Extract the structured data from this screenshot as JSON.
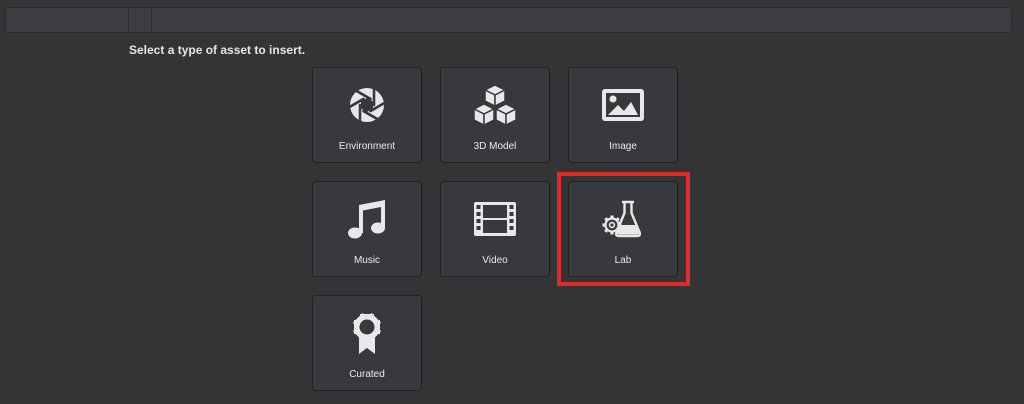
{
  "prompt": "Select a type of asset to insert.",
  "tiles": [
    {
      "label": "Environment",
      "icon": "aperture-icon"
    },
    {
      "label": "3D Model",
      "icon": "cubes-icon"
    },
    {
      "label": "Image",
      "icon": "image-icon"
    },
    {
      "label": "Music",
      "icon": "music-note-icon"
    },
    {
      "label": "Video",
      "icon": "film-strip-icon"
    },
    {
      "label": "Lab",
      "icon": "flask-gear-icon"
    },
    {
      "label": "Curated",
      "icon": "award-ribbon-icon"
    }
  ],
  "highlight": {
    "target": "Lab",
    "color": "#e32a2a"
  },
  "colors": {
    "background": "#323436",
    "tile": "#37393c",
    "icon": "#e8e8e8",
    "text": "#e6e6e6"
  }
}
